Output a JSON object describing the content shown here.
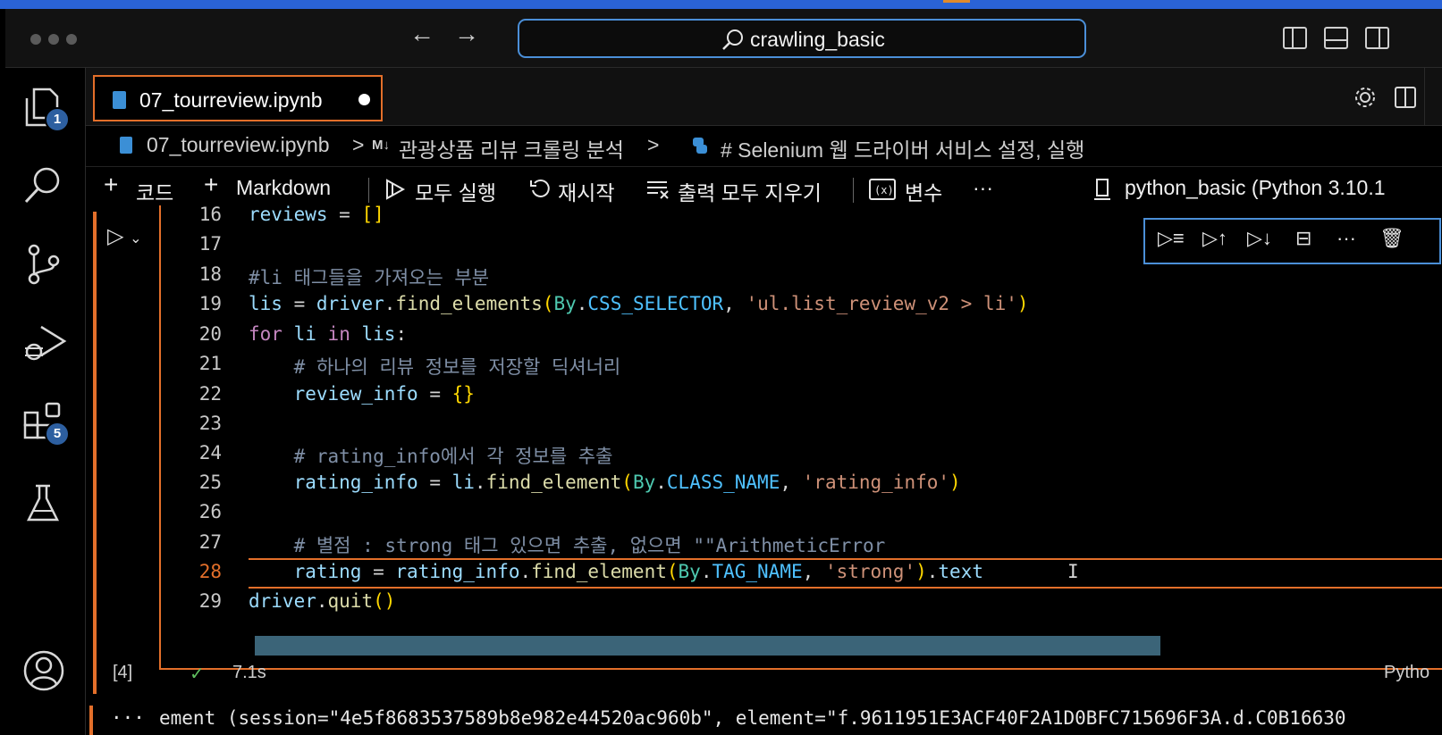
{
  "window": {
    "command_center": "crawling_basic"
  },
  "activity_bar": {
    "explorer_badge": "1",
    "extensions_badge": "5"
  },
  "tab": {
    "name": "07_tourreview.ipynb"
  },
  "breadcrumb": {
    "file": "07_tourreview.ipynb",
    "sep1": ">",
    "md_marker": "M↓",
    "section": "관광상품 리뷰 크롤링 분석",
    "sep2": ">",
    "cell": "# Selenium 웹 드라이버 서비스 설정, 실행"
  },
  "toolbar": {
    "code": "코드",
    "markdown": "Markdown",
    "run_all": "모두 실행",
    "restart": "재시작",
    "clear_outputs": "출력 모두 지우기",
    "variables": "변수",
    "more": "···",
    "kernel": "python_basic (Python 3.10.1"
  },
  "cell_toolbar": {
    "more": "···"
  },
  "code": {
    "lines": [
      {
        "n": "16",
        "t": "reviews = []"
      },
      {
        "n": "17",
        "t": ""
      },
      {
        "n": "18",
        "t": "#li 태그들을 가져오는 부분"
      },
      {
        "n": "19",
        "t": "lis = driver.find_elements(By.CSS_SELECTOR, 'ul.list_review_v2 > li')"
      },
      {
        "n": "20",
        "t": "for li in lis:"
      },
      {
        "n": "21",
        "t": "    # 하나의 리뷰 정보를 저장할 딕셔너리"
      },
      {
        "n": "22",
        "t": "    review_info = {}"
      },
      {
        "n": "23",
        "t": ""
      },
      {
        "n": "24",
        "t": "    # rating_info에서 각 정보를 추출"
      },
      {
        "n": "25",
        "t": "    rating_info = li.find_element(By.CLASS_NAME, 'rating_info')"
      },
      {
        "n": "26",
        "t": ""
      },
      {
        "n": "27",
        "t": "    # 별점 : strong 태그 있으면 추출, 없으면 \"\"ArithmeticError"
      },
      {
        "n": "28",
        "t": "    rating = rating_info.find_element(By.TAG_NAME, 'strong').text"
      },
      {
        "n": "29",
        "t": "driver.quit()"
      }
    ]
  },
  "cell_status": {
    "exec_count": "[4]",
    "check": "✓",
    "duration": "7.1s",
    "language": "Pytho"
  },
  "output": {
    "ellipsis": "···",
    "text": "ement (session=\"4e5f8683537589b8e982e44520ac960b\", element=\"f.9611951E3ACF40F2A1D0BFC715696F3A.d.C0B16630"
  },
  "colors": {
    "accent_orange": "#e36f2a",
    "focus_blue": "#4b8fd8",
    "badge_blue": "#2d5fa0"
  }
}
